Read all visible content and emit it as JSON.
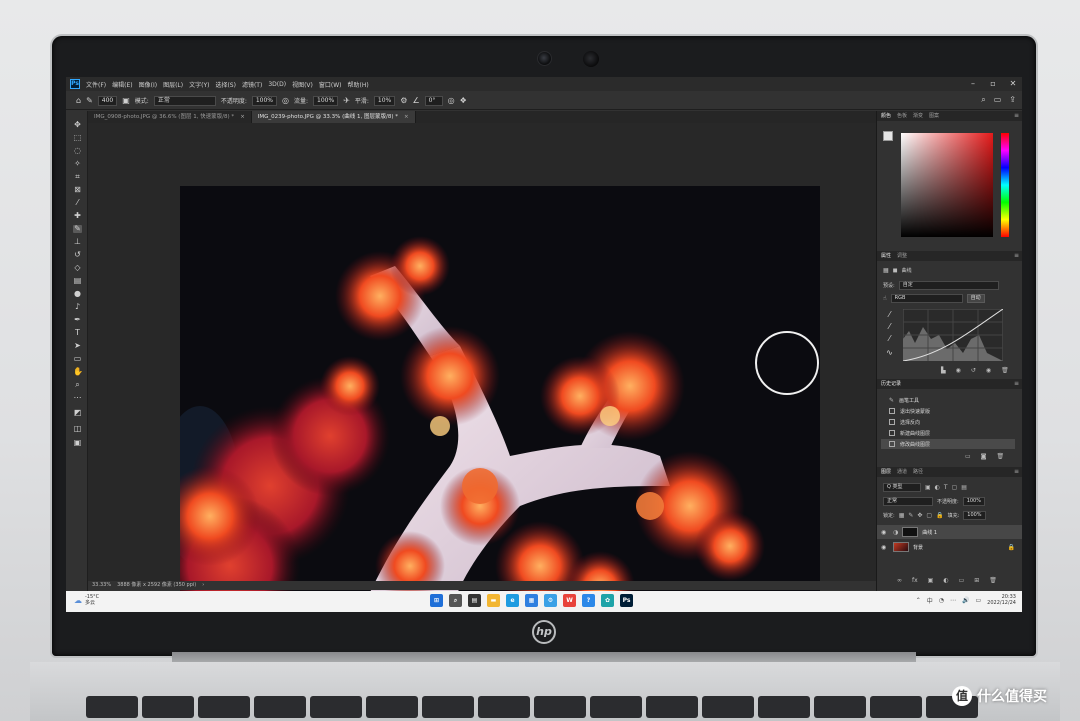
{
  "photo_overlay": {
    "watermark_logo": "值",
    "watermark_text": "什么值得买",
    "device_logo": "hp"
  },
  "menubar": {
    "app_badge": "Ps",
    "items": [
      "文件(F)",
      "编辑(E)",
      "图像(I)",
      "图层(L)",
      "文字(Y)",
      "选择(S)",
      "滤镜(T)",
      "3D(D)",
      "视图(V)",
      "窗口(W)",
      "帮助(H)"
    ],
    "window_controls": [
      "–",
      "▫",
      "✕"
    ]
  },
  "options_bar": {
    "brush_size": "400",
    "mode_label": "模式:",
    "mode_value": "正常",
    "opacity_label": "不透明度:",
    "opacity_value": "100%",
    "flow_label": "流量:",
    "flow_value": "100%",
    "smoothing_label": "平滑:",
    "smoothing_value": "10%",
    "angle_value": "0°"
  },
  "tabs": [
    {
      "label": "IMG_0908-photo.JPG @ 36.6% (图层 1, 快速蒙版/8) *",
      "active": false
    },
    {
      "label": "IMG_0239-photo.JPG @ 33.3% (曲线 1, 图层蒙版/8) *",
      "active": true
    }
  ],
  "statusbar": {
    "zoom": "33.33%",
    "doc_info": "3888 像素 x 2592 像素 (350 ppi)",
    "arrow": "›"
  },
  "panels": {
    "color_tabs": [
      "颜色",
      "色板",
      "渐变",
      "图案"
    ],
    "properties_tabs": [
      "属性",
      "调整"
    ],
    "properties_title": "曲线",
    "preset_label": "预设:",
    "preset_value": "自定",
    "channel_value": "RGB",
    "auto_button": "自动",
    "history_tab": "历史记录",
    "history_items": [
      "画笔工具",
      "退出快速蒙版",
      "选择反向",
      "新建曲线图层",
      "修改曲线图层"
    ],
    "layers_tabs": [
      "图层",
      "通道",
      "路径"
    ],
    "filter_value": "Q 类型",
    "blend_value": "正常",
    "opacity_label": "不透明度:",
    "opacity_value": "100%",
    "lock_label": "锁定:",
    "fill_label": "填充:",
    "fill_value": "100%",
    "layers": [
      {
        "name": "曲线 1",
        "selected": true
      },
      {
        "name": "背景",
        "selected": false
      }
    ],
    "footer_icons": [
      "∞",
      "fx",
      "▣",
      "◐",
      "▭",
      "⊞",
      "🗑"
    ]
  },
  "taskbar": {
    "weather_temp": "-15°C",
    "weather_desc": "多云",
    "apps": [
      {
        "name": "windows-start",
        "glyph": "⊞",
        "color": "#1f6fd8"
      },
      {
        "name": "search",
        "glyph": "⌕",
        "color": "#555555"
      },
      {
        "name": "task-view",
        "glyph": "▤",
        "color": "#333333"
      },
      {
        "name": "file-explorer",
        "glyph": "▬",
        "color": "#f2b632"
      },
      {
        "name": "edge",
        "glyph": "e",
        "color": "#1e9be0"
      },
      {
        "name": "store",
        "glyph": "▦",
        "color": "#2f7fe0"
      },
      {
        "name": "settings",
        "glyph": "⚙",
        "color": "#3aa0e6"
      },
      {
        "name": "wps",
        "glyph": "W",
        "color": "#e8423a"
      },
      {
        "name": "help",
        "glyph": "?",
        "color": "#2c88e8"
      },
      {
        "name": "photos",
        "glyph": "✿",
        "color": "#1fa3a8"
      },
      {
        "name": "photoshop",
        "glyph": "Ps",
        "color": "#001e36"
      }
    ],
    "tray": [
      "⌃",
      "中",
      "◔",
      "⋯",
      "🔊",
      "▭"
    ],
    "time": "20:33",
    "date": "2022/12/24"
  }
}
